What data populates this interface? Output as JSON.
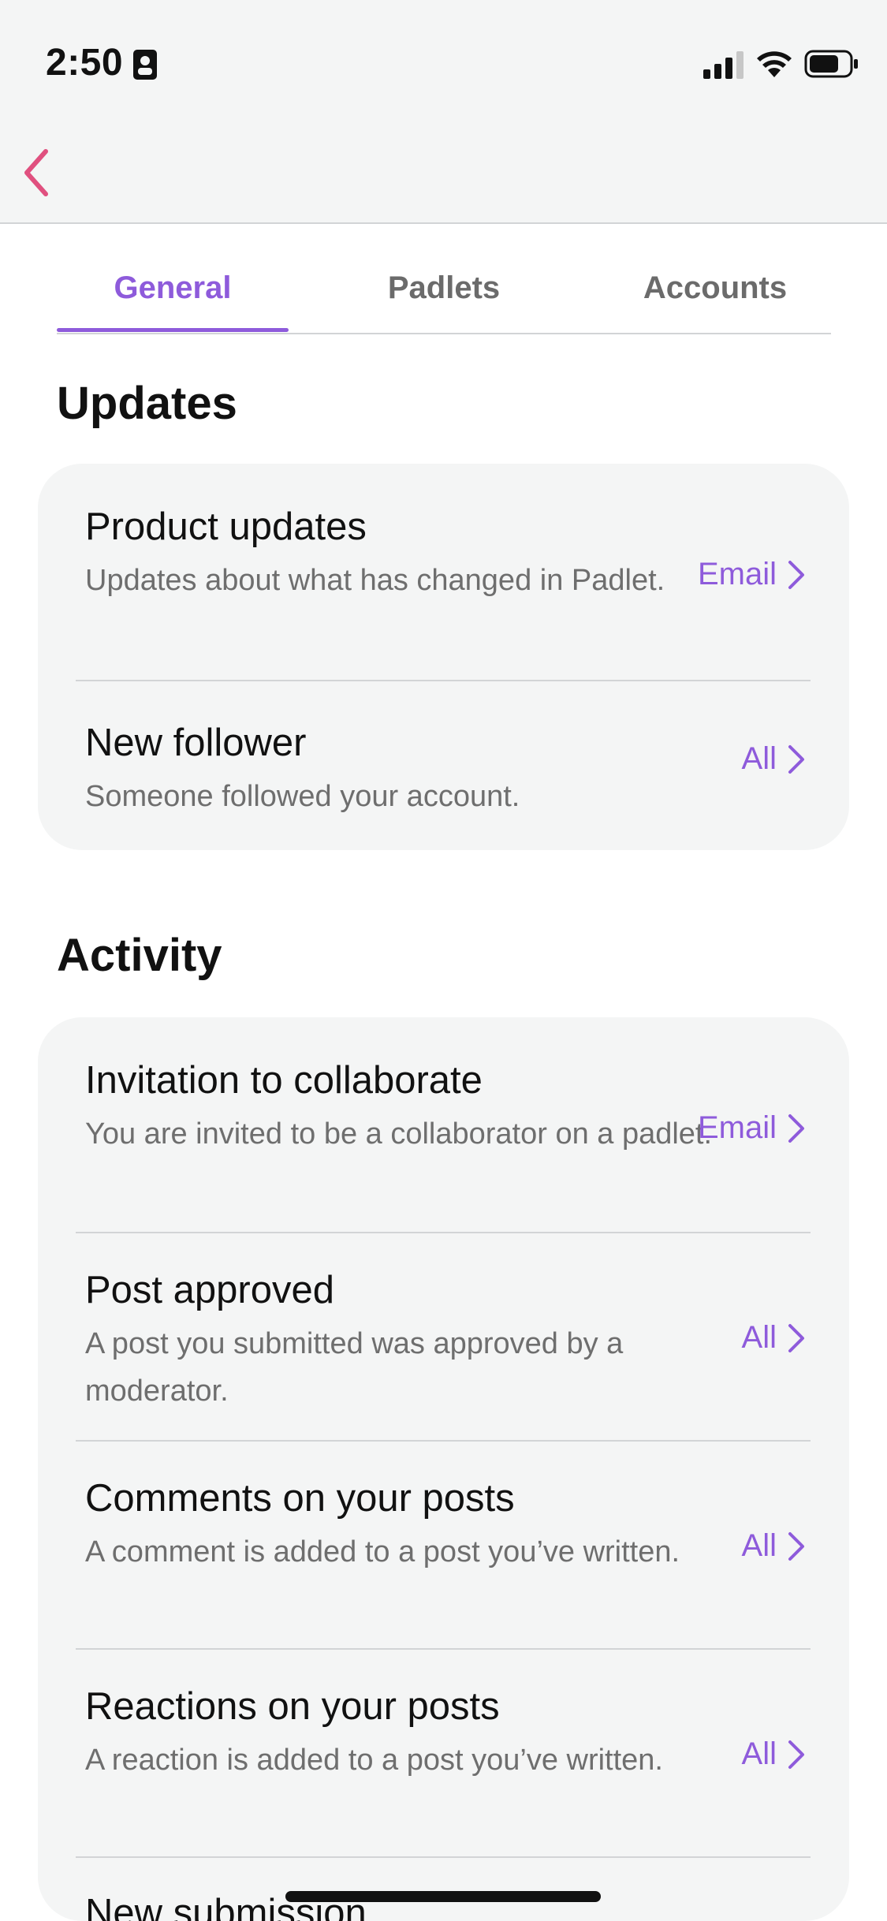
{
  "status_bar": {
    "time": "2:50"
  },
  "colors": {
    "accent": "#8e5bdb",
    "back": "#e0507f"
  },
  "tabs": [
    {
      "label": "General",
      "active": true
    },
    {
      "label": "Padlets",
      "active": false
    },
    {
      "label": "Accounts",
      "active": false
    }
  ],
  "sections": {
    "updates": {
      "title": "Updates",
      "items": [
        {
          "title": "Product updates",
          "description": "Updates about what has changed in Padlet.",
          "value": "Email"
        },
        {
          "title": "New follower",
          "description": "Someone followed your account.",
          "value": "All"
        }
      ]
    },
    "activity": {
      "title": "Activity",
      "items": [
        {
          "title": "Invitation to collaborate",
          "description": "You are invited to be a collaborator on a padlet.",
          "value": "Email"
        },
        {
          "title": "Post approved",
          "description": "A post you submitted was approved by a moderator.",
          "value": "All"
        },
        {
          "title": "Comments on your posts",
          "description": "A comment is added to a post you’ve written.",
          "value": "All"
        },
        {
          "title": "Reactions on your posts",
          "description": "A reaction is added to a post you’ve written.",
          "value": "All"
        },
        {
          "title": "New submission",
          "description": "",
          "value": ""
        }
      ]
    }
  }
}
